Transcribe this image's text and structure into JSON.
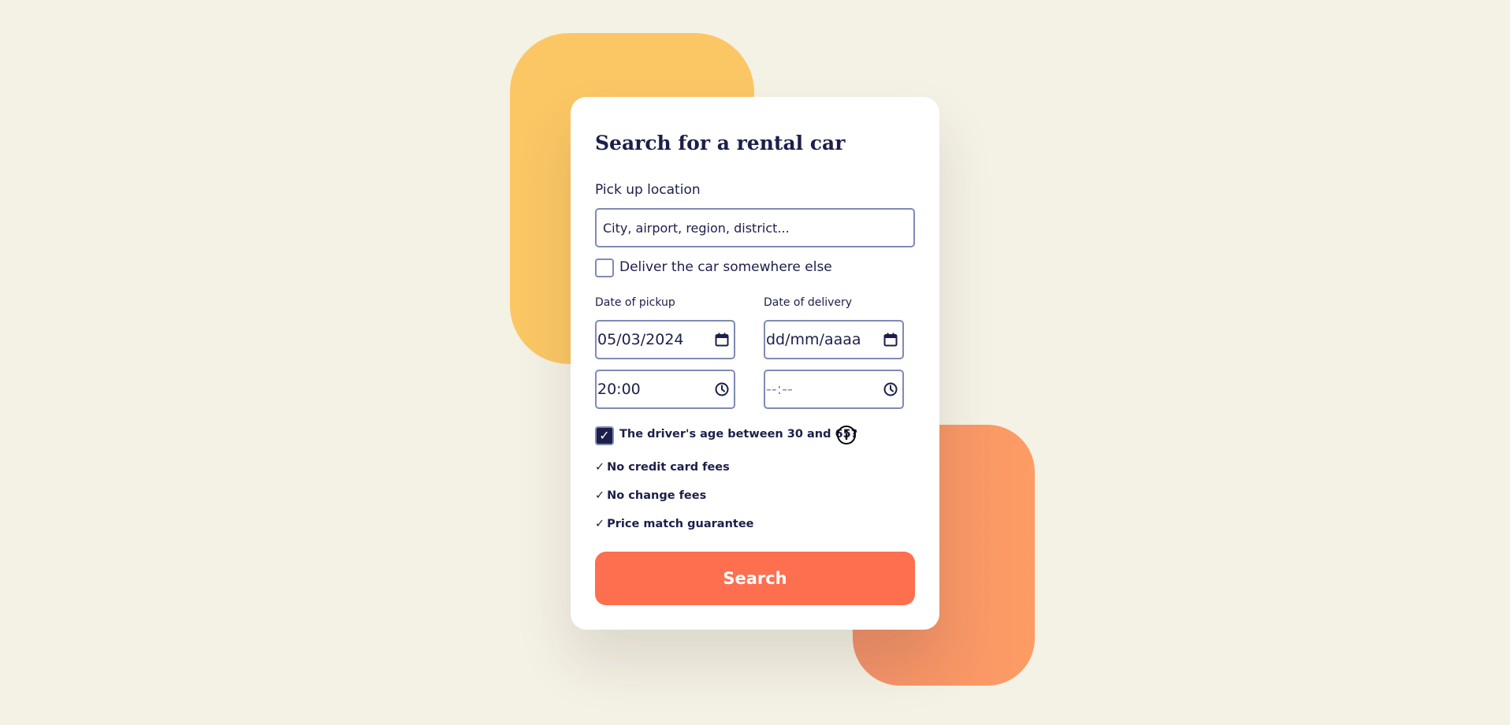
{
  "form": {
    "title": "Search for a rental car",
    "pickup_location_label": "Pick up location",
    "pickup_location_placeholder": "City, airport, region, district...",
    "deliver_elsewhere_label": "Deliver the car somewhere else",
    "deliver_elsewhere_checked": false,
    "date_of_pickup_label": "Date of pickup",
    "date_of_delivery_label": "Date of delivery",
    "pickup_date_value": "05/03/2024",
    "delivery_date_placeholder": "dd/mm/aaaa",
    "pickup_time_value": "20:00",
    "delivery_time_placeholder": "--:--",
    "driver_age_label": "The driver's age between 30 and 65?",
    "driver_age_checked": true,
    "driver_age_check_glyph": "✓",
    "features": [
      "No credit card fees",
      "No change fees",
      "Price match guarantee"
    ],
    "feature_tick": "✓",
    "search_label": "Search"
  },
  "icons": {
    "date": "calendar-icon",
    "time": "clock-icon",
    "info": "info-icon"
  },
  "colors": {
    "background": "#f4f1e5",
    "navy": "#1c1f4a",
    "input_border": "#7f8ab6",
    "button": "#fe6f4f",
    "yellow_shape": "#fbc765",
    "orange_shape": "#f79966"
  }
}
